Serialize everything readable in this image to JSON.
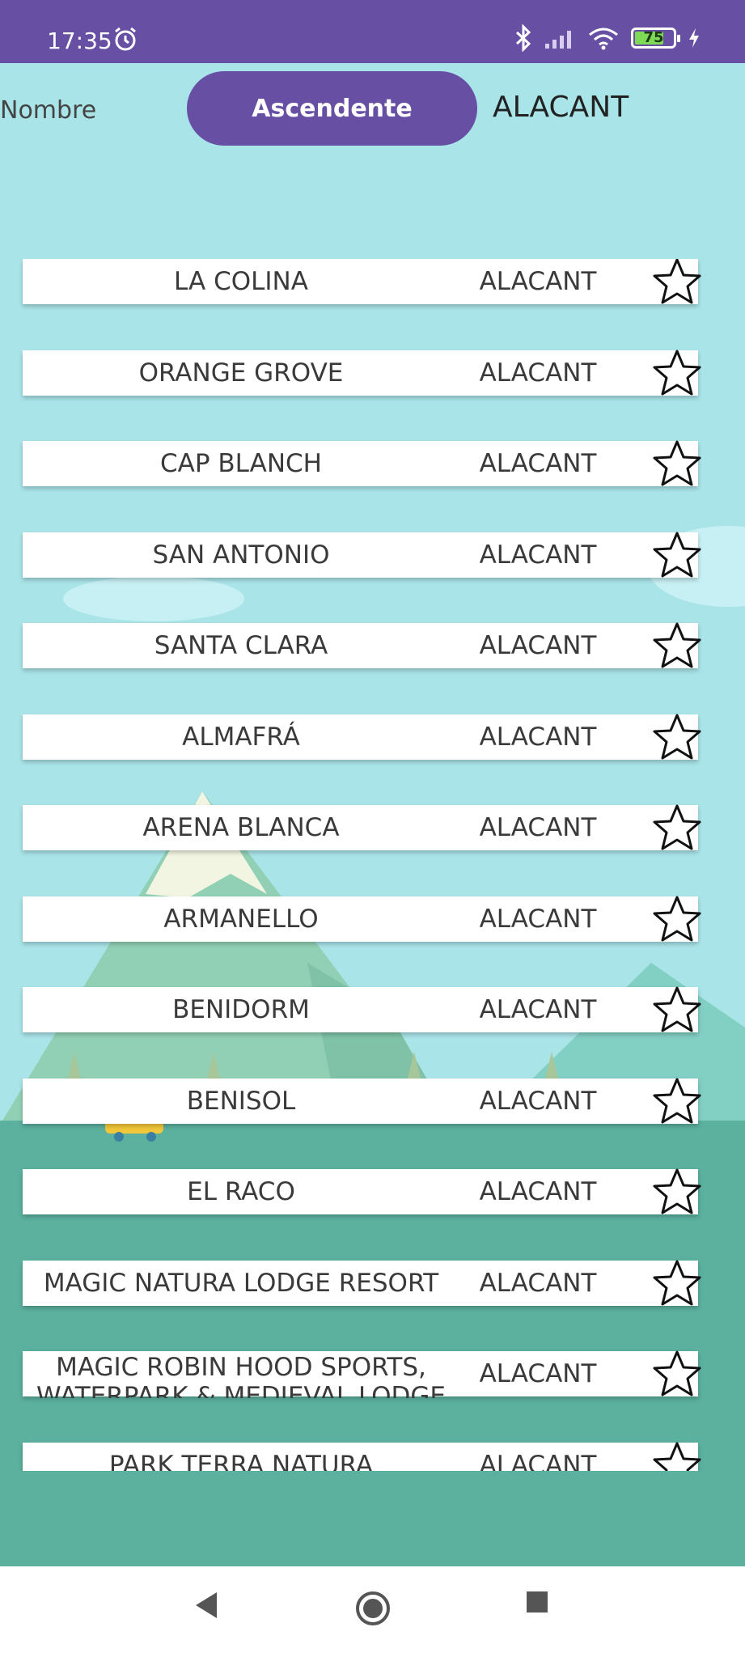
{
  "status_bar": {
    "time": "17:35",
    "battery_percent": "75",
    "battery_level": 0.75,
    "icons": [
      "alarm-icon",
      "bluetooth-icon",
      "signal-icon",
      "wifi-icon",
      "battery-icon",
      "charging-icon"
    ]
  },
  "toolbar": {
    "sort_field": "Nombre",
    "order_button": "Ascendente",
    "province": "ALACANT"
  },
  "beaches": [
    {
      "name": "LA COLINA",
      "province": "ALACANT"
    },
    {
      "name": "ORANGE GROVE",
      "province": "ALACANT"
    },
    {
      "name": "CAP BLANCH",
      "province": "ALACANT"
    },
    {
      "name": "SAN ANTONIO",
      "province": "ALACANT"
    },
    {
      "name": "SANTA CLARA",
      "province": "ALACANT"
    },
    {
      "name": "ALMAFRÁ",
      "province": "ALACANT"
    },
    {
      "name": "ARENA BLANCA",
      "province": "ALACANT"
    },
    {
      "name": "ARMANELLO",
      "province": "ALACANT"
    },
    {
      "name": "BENIDORM",
      "province": "ALACANT"
    },
    {
      "name": "BENISOL",
      "province": "ALACANT"
    },
    {
      "name": "EL RACO",
      "province": "ALACANT"
    },
    {
      "name": "MAGIC NATURA LODGE RESORT",
      "province": "ALACANT"
    },
    {
      "name": "MAGIC ROBIN HOOD SPORTS, WATERPARK & MEDIEVAL LODGE",
      "province": "ALACANT"
    },
    {
      "name": "PARK TERRA NATURA",
      "province": "ALACANT"
    }
  ],
  "colors": {
    "primary": "#6750a4",
    "sky": "#a9e4e8",
    "grass": "#5bb09e"
  },
  "nav": {
    "icons": [
      "back-icon",
      "home-icon",
      "recents-icon"
    ]
  }
}
